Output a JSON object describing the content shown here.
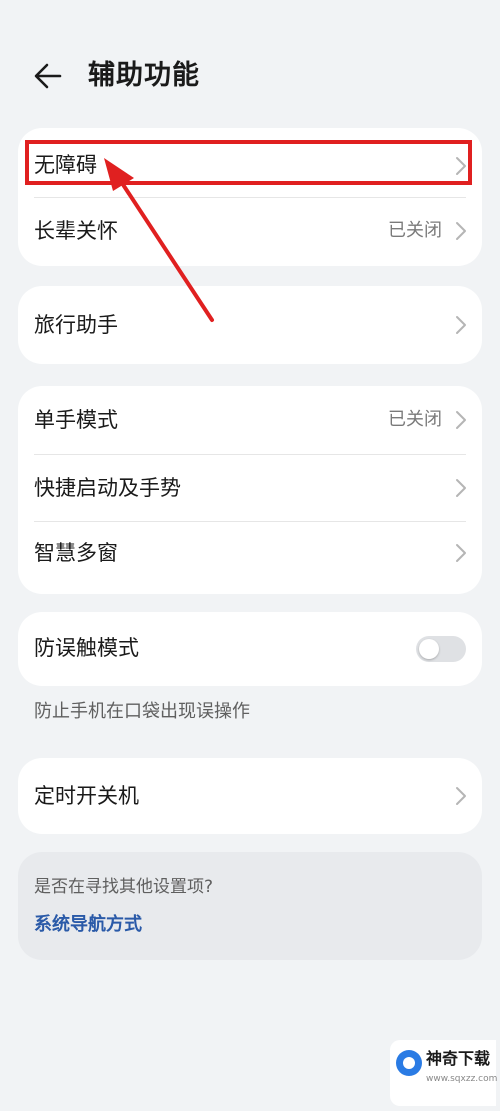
{
  "header": {
    "title": "辅助功能"
  },
  "group1": {
    "items": [
      {
        "label": "无障碍",
        "value": ""
      },
      {
        "label": "长辈关怀",
        "value": "已关闭"
      }
    ]
  },
  "group2": {
    "items": [
      {
        "label": "旅行助手"
      }
    ]
  },
  "group3": {
    "items": [
      {
        "label": "单手模式",
        "value": "已关闭"
      },
      {
        "label": "快捷启动及手势"
      },
      {
        "label": "智慧多窗"
      }
    ]
  },
  "group4": {
    "label": "防误触模式",
    "toggle_on": false,
    "caption": "防止手机在口袋出现误操作"
  },
  "group5": {
    "items": [
      {
        "label": "定时开关机"
      }
    ]
  },
  "search": {
    "question": "是否在寻找其他设置项?",
    "link": "系统导航方式"
  },
  "watermark": {
    "title": "神奇下载",
    "url": "www.sqxzz.com"
  },
  "colors": {
    "highlight": "#e02020",
    "link": "#2a5aa8",
    "background": "#f1f3f5"
  }
}
